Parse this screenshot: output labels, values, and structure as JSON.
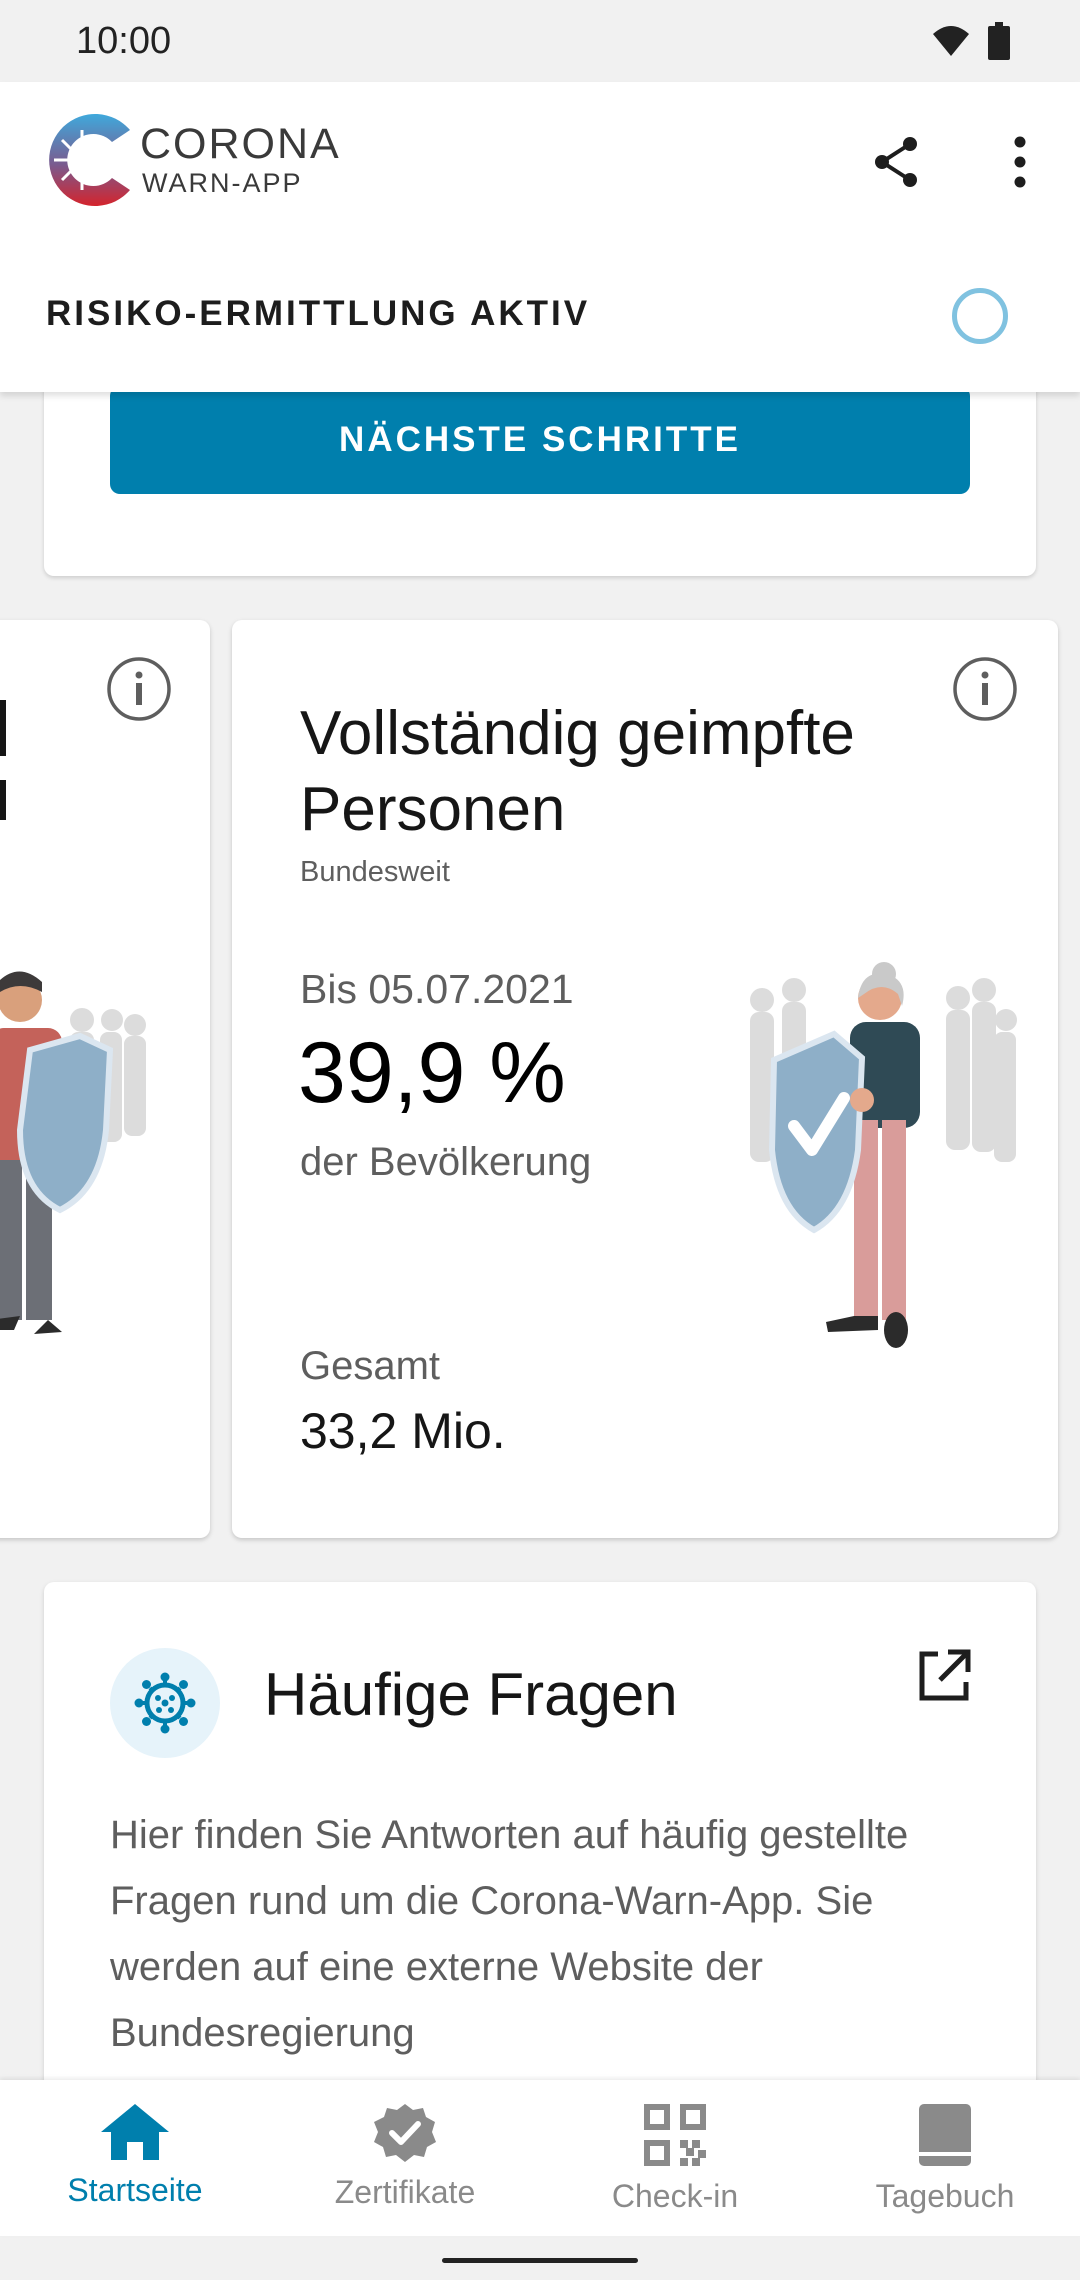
{
  "status_bar": {
    "time": "10:00",
    "icons": [
      "wifi-icon",
      "battery-icon"
    ]
  },
  "header": {
    "logo_line1": "CORONA",
    "logo_line2": "WARN-APP",
    "share_icon": "share-icon",
    "menu_icon": "more-vert-icon",
    "risk_label": "RISIKO-ERMITTLUNG AKTIV"
  },
  "top_card": {
    "button_label": "NÄCHSTE SCHRITTE"
  },
  "stats": {
    "main": {
      "title": "Vollständig geimpfte Personen",
      "subtitle": "Bundesweit",
      "date": "Bis 05.07.2021",
      "value": "39,9 %",
      "unit": "der Bevölkerung",
      "total_label": "Gesamt",
      "total_value": "33,2 Mio."
    }
  },
  "faq": {
    "title": "Häufige Fragen",
    "body": "Hier finden Sie Antworten auf häufig gestellte Fragen rund um die Corona-Warn-App. Sie werden auf eine externe Website der Bundesregierung"
  },
  "bottom_nav": {
    "items": [
      {
        "label": "Startseite",
        "icon": "home-icon",
        "active": true
      },
      {
        "label": "Zertifikate",
        "icon": "certificate-icon",
        "active": false
      },
      {
        "label": "Check-in",
        "icon": "qr-code-icon",
        "active": false
      },
      {
        "label": "Tagebuch",
        "icon": "book-icon",
        "active": false
      }
    ]
  },
  "colors": {
    "accent": "#007fad",
    "ring": "#80c2e0",
    "background": "#f1f1f1"
  }
}
